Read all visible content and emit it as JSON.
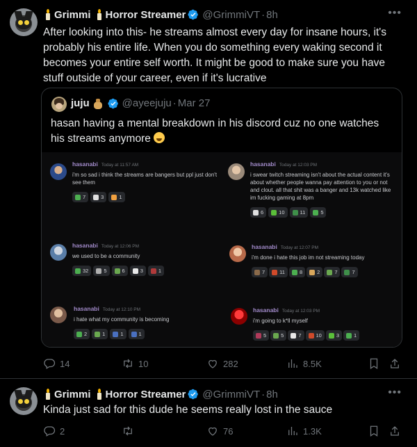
{
  "tweets": [
    {
      "display_name_1": "Grimmi",
      "display_name_2": "Horror Streamer",
      "handle": "@GrimmiVT",
      "time": "8h",
      "text": "After looking into this- he streams almost every day for insane hours, it's probably his entire life. When you do something every waking second it becomes your entire self worth. It might be good to make sure you have stuff outside of your career, even if it's lucrative",
      "quote": {
        "name": "juju",
        "handle": "@ayeejuju",
        "time": "Mar 27",
        "text": "hasan having a mental breakdown in his discord cuz no one watches his streams anymore",
        "screenshot": {
          "messages": [
            {
              "user": "hasanabi",
              "time": "Today at 11:57 AM",
              "text": "i'm so sad i think the streams are bangers but ppl just don't see them",
              "reactions": [
                "7",
                "3",
                "1"
              ]
            },
            {
              "user": "hasanabi",
              "time": "Today at 12:03 PM",
              "text": "i swear twitch streaming isn't about the actual content it's about whether people wanna pay attention to you or not and clout. all that shit was a banger and 13k watched like im fucking gaming at 8pm",
              "reactions": [
                "6",
                "10",
                "11",
                "5"
              ]
            },
            {
              "user": "hasanabi",
              "time": "Today at 12:06 PM",
              "text": "we used to be a community",
              "reactions": [
                "32",
                "5",
                "6",
                "3",
                "1"
              ]
            },
            {
              "user": "hasanabi",
              "time": "Today at 12:07 PM",
              "text": "i'm done i hate this job im not streaming today",
              "reactions": [
                "7",
                "11",
                "8",
                "2",
                "7",
                "7"
              ]
            },
            {
              "user": "hasanabi",
              "time": "Today at 12:10 PM",
              "text": "i hate what my community is becoming",
              "reactions": [
                "2",
                "1",
                "1",
                "1"
              ]
            },
            {
              "user": "hasanabi",
              "time": "Today at 12:03 PM",
              "text": "i'm going to k*ll myself",
              "reactions": [
                "5",
                "5",
                "7",
                "10",
                "3",
                "1"
              ]
            }
          ]
        }
      },
      "stats": {
        "replies": "14",
        "retweets": "10",
        "likes": "282",
        "views": "8.5K"
      }
    },
    {
      "display_name_1": "Grimmi",
      "display_name_2": "Horror Streamer",
      "handle": "@GrimmiVT",
      "time": "8h",
      "text": "Kinda just sad for this dude he seems really lost in the sauce",
      "stats": {
        "replies": "2",
        "retweets": "",
        "likes": "76",
        "views": "1.3K"
      }
    }
  ],
  "colors": {
    "background": "#000000",
    "text": "#e7e9ea",
    "muted": "#71767b",
    "verified": "#1d9bf0",
    "border": "#2f3336"
  },
  "icons": [
    "more-icon",
    "verified-icon",
    "reply-icon",
    "retweet-icon",
    "like-icon",
    "views-icon",
    "bookmark-icon",
    "share-icon"
  ]
}
